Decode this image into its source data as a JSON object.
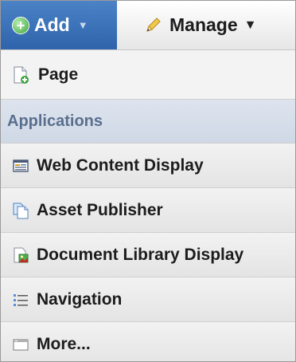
{
  "dock": {
    "add_label": "Add",
    "manage_label": "Manage"
  },
  "menu": {
    "page_label": "Page",
    "section_header": "Applications",
    "items": [
      {
        "label": "Web Content Display",
        "icon": "web-content-display-icon"
      },
      {
        "label": "Asset Publisher",
        "icon": "asset-publisher-icon"
      },
      {
        "label": "Document Library Display",
        "icon": "document-library-icon"
      },
      {
        "label": "Navigation",
        "icon": "navigation-icon"
      },
      {
        "label": "More...",
        "icon": "more-icon"
      }
    ]
  },
  "colors": {
    "add_button_bg": "#3a6fb5",
    "section_text": "#5a6f8e",
    "section_bg": "#d6deea"
  }
}
